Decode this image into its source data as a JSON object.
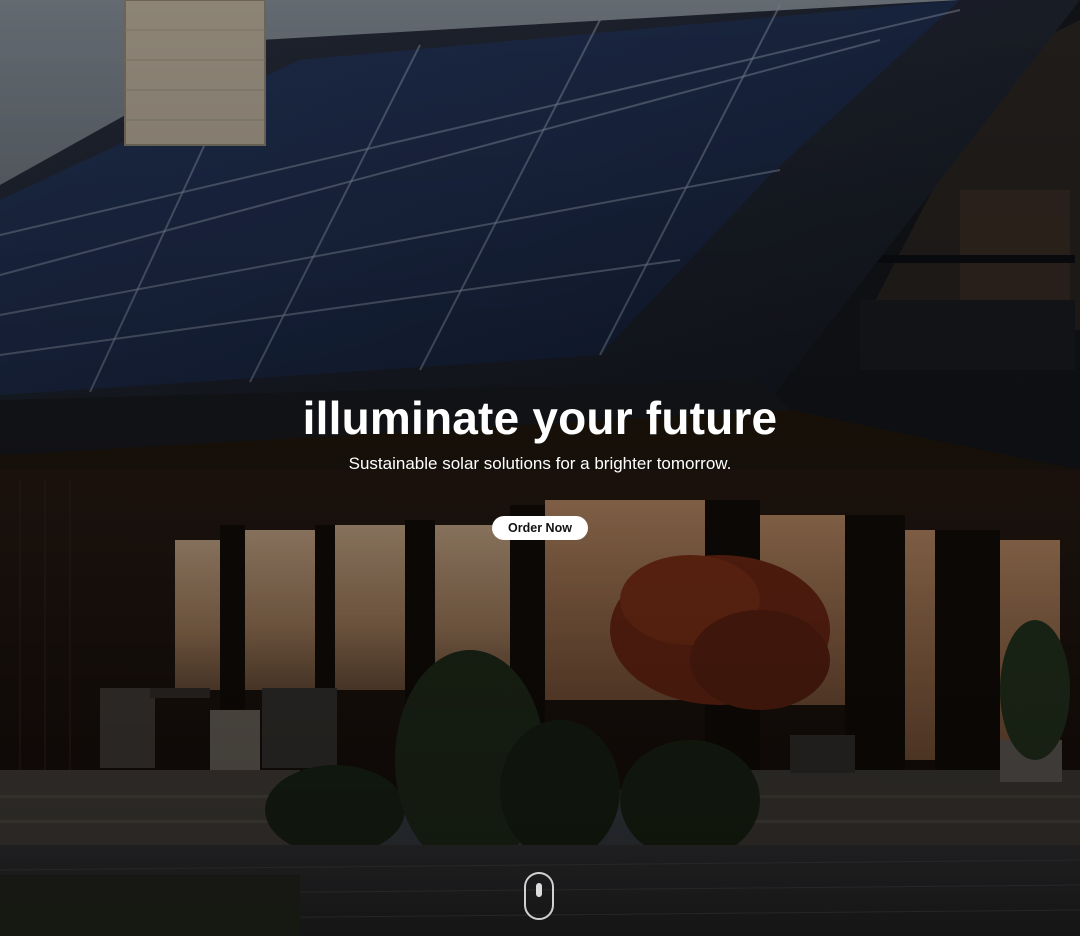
{
  "hero": {
    "headline": "illuminate your future",
    "subheadline": "Sustainable solar solutions for a brighter tomorrow.",
    "cta_label": "Order Now",
    "background_image": "house-with-solar-panels-photo",
    "scroll_indicator_icon": "mouse-scroll-icon"
  }
}
